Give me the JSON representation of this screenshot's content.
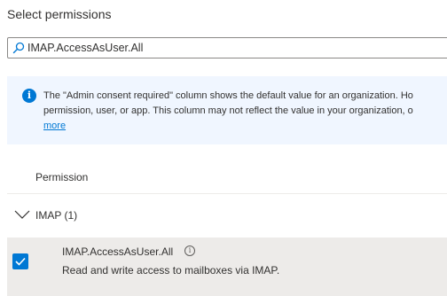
{
  "section": {
    "title": "Select permissions"
  },
  "search": {
    "value": "IMAP.AccessAsUser.All",
    "icon": "search-icon"
  },
  "info_bar": {
    "icon": "info-icon",
    "line1": "The \"Admin consent required\" column shows the default value for an organization. Ho",
    "line2": "permission, user, or app. This column may not reflect the value in your organization, o",
    "link": "more",
    "accent_color": "#0078d4",
    "background_color": "#f0f6ff"
  },
  "table": {
    "column_header": "Permission",
    "group": {
      "label": "IMAP (1)",
      "icon": "chevron-down-icon"
    },
    "rows": [
      {
        "checked": true,
        "name": "IMAP.AccessAsUser.All",
        "info_icon": "info-icon",
        "description": "Read and write access to mailboxes via IMAP."
      }
    ]
  }
}
